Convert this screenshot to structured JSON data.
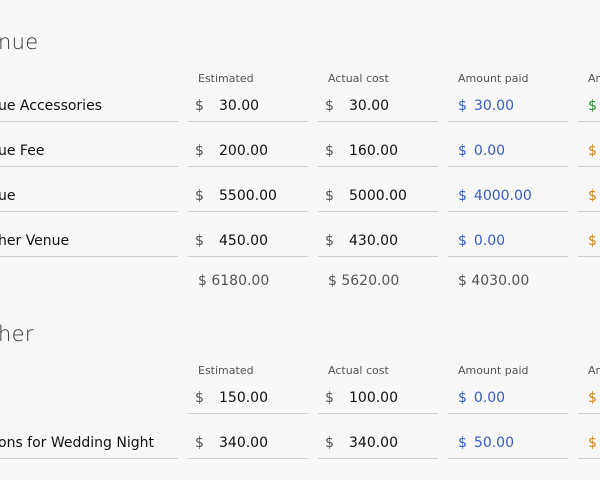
{
  "sections": [
    {
      "title": "nue",
      "headers": {
        "estimated": "Estimated",
        "actual": "Actual cost",
        "paid": "Amount paid",
        "due": "Am"
      },
      "rows": [
        {
          "name": "ue Accessories",
          "estimated": "30.00",
          "actual": "30.00",
          "paid": "30.00",
          "due_color": "green"
        },
        {
          "name": "ue Fee",
          "estimated": "200.00",
          "actual": "160.00",
          "paid": "0.00",
          "due_color": "orange"
        },
        {
          "name": "ue",
          "estimated": "5500.00",
          "actual": "5000.00",
          "paid": "4000.00",
          "due_color": "orange"
        },
        {
          "name": "her Venue",
          "estimated": "450.00",
          "actual": "430.00",
          "paid": "0.00",
          "due_color": "orange"
        }
      ],
      "totals": {
        "estimated": "$ 6180.00",
        "actual": "$ 5620.00",
        "paid": "$ 4030.00"
      }
    },
    {
      "title": "her",
      "headers": {
        "estimated": "Estimated",
        "actual": "Actual cost",
        "paid": "Amount paid",
        "due": "Am"
      },
      "rows": [
        {
          "name": "",
          "estimated": "150.00",
          "actual": "100.00",
          "paid": "0.00",
          "due_color": "orange"
        },
        {
          "name": "ons for Wedding Night",
          "estimated": "340.00",
          "actual": "340.00",
          "paid": "50.00",
          "due_color": "orange"
        }
      ]
    }
  ],
  "currency_symbol": "$",
  "colors": {
    "paid": "#3a5bc7",
    "due_green": "#2e8b3a",
    "due_orange": "#d4861f"
  }
}
